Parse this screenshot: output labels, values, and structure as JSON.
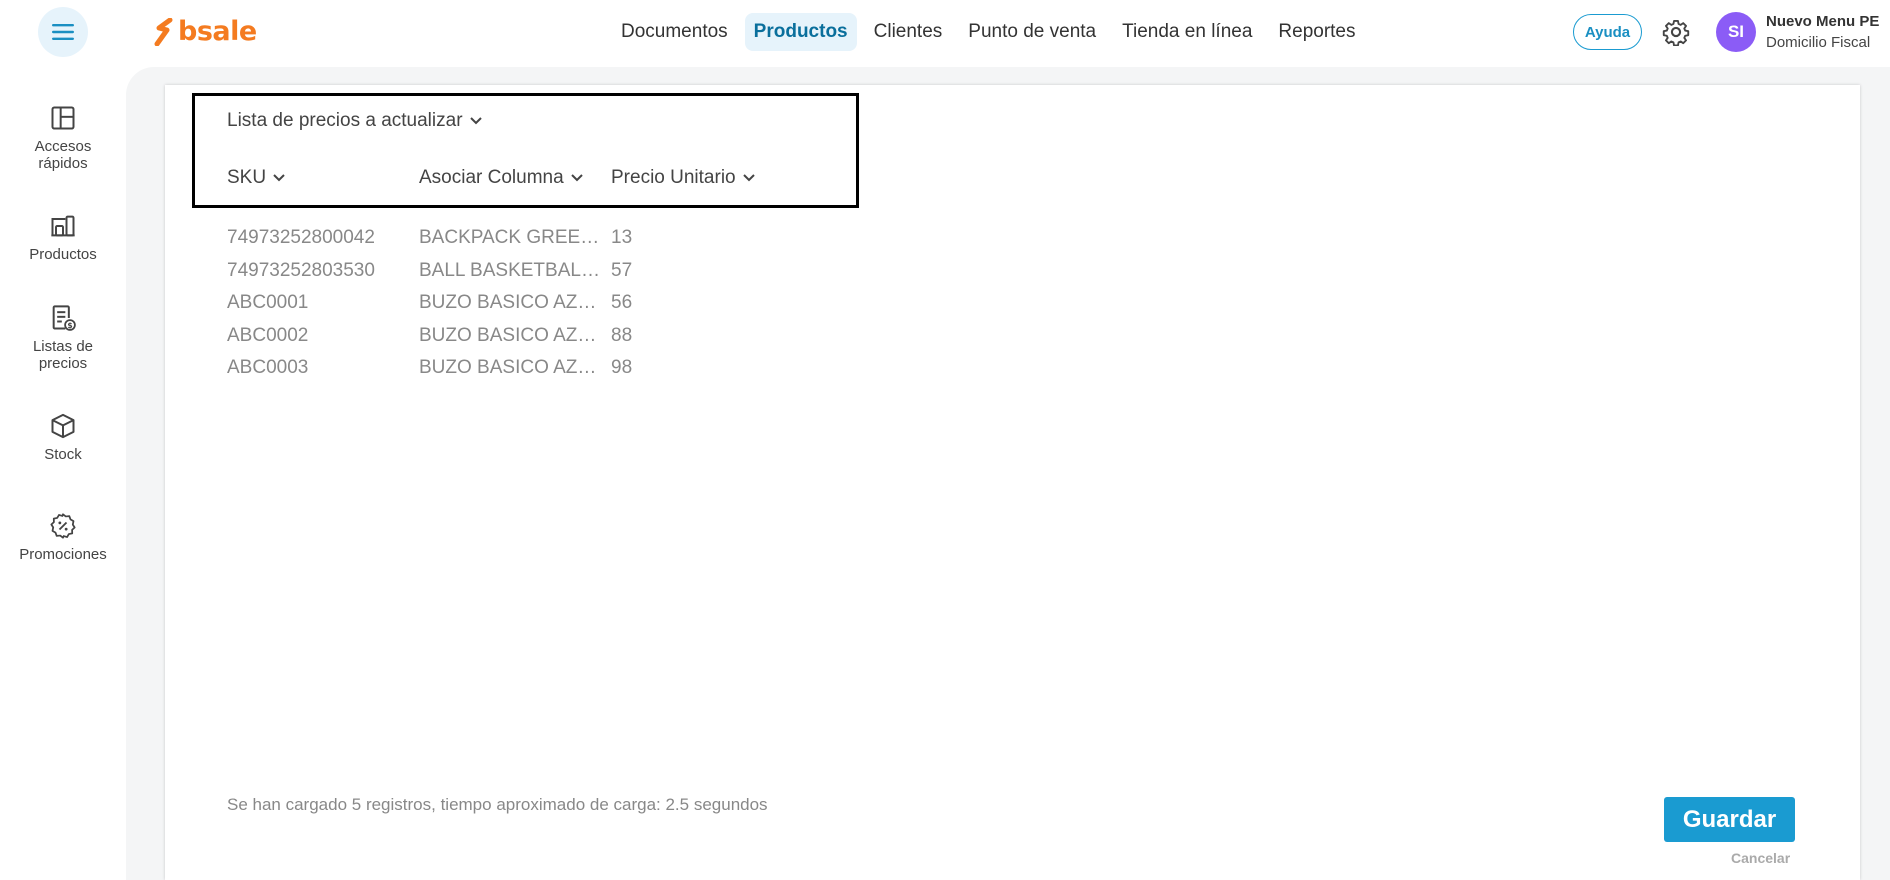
{
  "app": {
    "brand": "bsale"
  },
  "header": {
    "nav": [
      {
        "label": "Documentos",
        "active": false
      },
      {
        "label": "Productos",
        "active": true
      },
      {
        "label": "Clientes",
        "active": false
      },
      {
        "label": "Punto de venta",
        "active": false
      },
      {
        "label": "Tienda en línea",
        "active": false
      },
      {
        "label": "Reportes",
        "active": false
      }
    ],
    "help_label": "Ayuda",
    "user": {
      "initials": "SI",
      "name": "Nuevo Menu PE",
      "subtitle": "Domicilio Fiscal"
    }
  },
  "sidebar": {
    "items": [
      {
        "label": "Accesos rápidos",
        "icon": "layout-icon"
      },
      {
        "label": "Productos",
        "icon": "products-icon"
      },
      {
        "label": "Listas de precios",
        "icon": "price-list-icon"
      },
      {
        "label": "Stock",
        "icon": "box-icon"
      },
      {
        "label": "Promociones",
        "icon": "discount-badge-icon"
      }
    ]
  },
  "main": {
    "price_list_dropdown": "Lista de precios a actualizar",
    "columns": [
      {
        "label": "SKU"
      },
      {
        "label": "Asociar Columna"
      },
      {
        "label": "Precio Unitario"
      }
    ],
    "rows": [
      {
        "sku": "74973252800042",
        "name": "BACKPACK GREEN/BLACK",
        "price": "13"
      },
      {
        "sku": "74973252803530",
        "name": "BALL BASKETBALL NBA",
        "price": "57"
      },
      {
        "sku": "ABC0001",
        "name": "BUZO BASICO AZUL S",
        "price": "56"
      },
      {
        "sku": "ABC0002",
        "name": "BUZO BASICO AZUL M",
        "price": "88"
      },
      {
        "sku": "ABC0003",
        "name": "BUZO BASICO AZUL L",
        "price": "98"
      }
    ],
    "footer_status": "Se han cargado 5 registros, tiempo aproximado de carga: 2.5 segundos",
    "save_label": "Guardar",
    "cancel_label": "Cancelar"
  },
  "colors": {
    "accent": "#1a9bd1",
    "brand": "#f47b20",
    "avatar": "#8b5cf6",
    "highlight_border": "#000000"
  }
}
